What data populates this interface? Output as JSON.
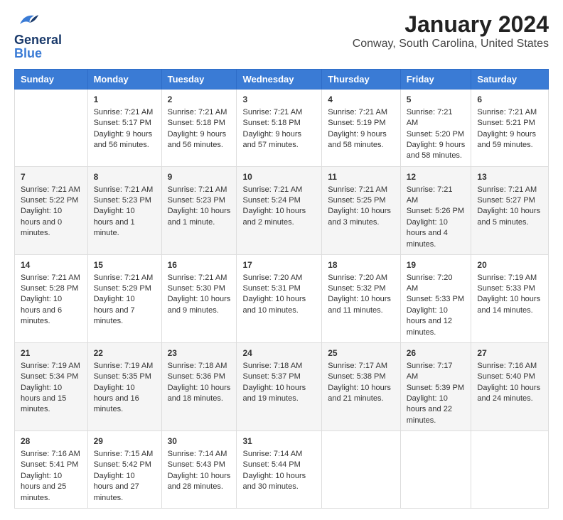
{
  "header": {
    "logo_general": "General",
    "logo_blue": "Blue",
    "title": "January 2024",
    "subtitle": "Conway, South Carolina, United States"
  },
  "days_of_week": [
    "Sunday",
    "Monday",
    "Tuesday",
    "Wednesday",
    "Thursday",
    "Friday",
    "Saturday"
  ],
  "weeks": [
    [
      {
        "date": "",
        "sunrise": "",
        "sunset": "",
        "daylight": ""
      },
      {
        "date": "1",
        "sunrise": "Sunrise: 7:21 AM",
        "sunset": "Sunset: 5:17 PM",
        "daylight": "Daylight: 9 hours and 56 minutes."
      },
      {
        "date": "2",
        "sunrise": "Sunrise: 7:21 AM",
        "sunset": "Sunset: 5:18 PM",
        "daylight": "Daylight: 9 hours and 56 minutes."
      },
      {
        "date": "3",
        "sunrise": "Sunrise: 7:21 AM",
        "sunset": "Sunset: 5:18 PM",
        "daylight": "Daylight: 9 hours and 57 minutes."
      },
      {
        "date": "4",
        "sunrise": "Sunrise: 7:21 AM",
        "sunset": "Sunset: 5:19 PM",
        "daylight": "Daylight: 9 hours and 58 minutes."
      },
      {
        "date": "5",
        "sunrise": "Sunrise: 7:21 AM",
        "sunset": "Sunset: 5:20 PM",
        "daylight": "Daylight: 9 hours and 58 minutes."
      },
      {
        "date": "6",
        "sunrise": "Sunrise: 7:21 AM",
        "sunset": "Sunset: 5:21 PM",
        "daylight": "Daylight: 9 hours and 59 minutes."
      }
    ],
    [
      {
        "date": "7",
        "sunrise": "Sunrise: 7:21 AM",
        "sunset": "Sunset: 5:22 PM",
        "daylight": "Daylight: 10 hours and 0 minutes."
      },
      {
        "date": "8",
        "sunrise": "Sunrise: 7:21 AM",
        "sunset": "Sunset: 5:23 PM",
        "daylight": "Daylight: 10 hours and 1 minute."
      },
      {
        "date": "9",
        "sunrise": "Sunrise: 7:21 AM",
        "sunset": "Sunset: 5:23 PM",
        "daylight": "Daylight: 10 hours and 1 minute."
      },
      {
        "date": "10",
        "sunrise": "Sunrise: 7:21 AM",
        "sunset": "Sunset: 5:24 PM",
        "daylight": "Daylight: 10 hours and 2 minutes."
      },
      {
        "date": "11",
        "sunrise": "Sunrise: 7:21 AM",
        "sunset": "Sunset: 5:25 PM",
        "daylight": "Daylight: 10 hours and 3 minutes."
      },
      {
        "date": "12",
        "sunrise": "Sunrise: 7:21 AM",
        "sunset": "Sunset: 5:26 PM",
        "daylight": "Daylight: 10 hours and 4 minutes."
      },
      {
        "date": "13",
        "sunrise": "Sunrise: 7:21 AM",
        "sunset": "Sunset: 5:27 PM",
        "daylight": "Daylight: 10 hours and 5 minutes."
      }
    ],
    [
      {
        "date": "14",
        "sunrise": "Sunrise: 7:21 AM",
        "sunset": "Sunset: 5:28 PM",
        "daylight": "Daylight: 10 hours and 6 minutes."
      },
      {
        "date": "15",
        "sunrise": "Sunrise: 7:21 AM",
        "sunset": "Sunset: 5:29 PM",
        "daylight": "Daylight: 10 hours and 7 minutes."
      },
      {
        "date": "16",
        "sunrise": "Sunrise: 7:21 AM",
        "sunset": "Sunset: 5:30 PM",
        "daylight": "Daylight: 10 hours and 9 minutes."
      },
      {
        "date": "17",
        "sunrise": "Sunrise: 7:20 AM",
        "sunset": "Sunset: 5:31 PM",
        "daylight": "Daylight: 10 hours and 10 minutes."
      },
      {
        "date": "18",
        "sunrise": "Sunrise: 7:20 AM",
        "sunset": "Sunset: 5:32 PM",
        "daylight": "Daylight: 10 hours and 11 minutes."
      },
      {
        "date": "19",
        "sunrise": "Sunrise: 7:20 AM",
        "sunset": "Sunset: 5:33 PM",
        "daylight": "Daylight: 10 hours and 12 minutes."
      },
      {
        "date": "20",
        "sunrise": "Sunrise: 7:19 AM",
        "sunset": "Sunset: 5:33 PM",
        "daylight": "Daylight: 10 hours and 14 minutes."
      }
    ],
    [
      {
        "date": "21",
        "sunrise": "Sunrise: 7:19 AM",
        "sunset": "Sunset: 5:34 PM",
        "daylight": "Daylight: 10 hours and 15 minutes."
      },
      {
        "date": "22",
        "sunrise": "Sunrise: 7:19 AM",
        "sunset": "Sunset: 5:35 PM",
        "daylight": "Daylight: 10 hours and 16 minutes."
      },
      {
        "date": "23",
        "sunrise": "Sunrise: 7:18 AM",
        "sunset": "Sunset: 5:36 PM",
        "daylight": "Daylight: 10 hours and 18 minutes."
      },
      {
        "date": "24",
        "sunrise": "Sunrise: 7:18 AM",
        "sunset": "Sunset: 5:37 PM",
        "daylight": "Daylight: 10 hours and 19 minutes."
      },
      {
        "date": "25",
        "sunrise": "Sunrise: 7:17 AM",
        "sunset": "Sunset: 5:38 PM",
        "daylight": "Daylight: 10 hours and 21 minutes."
      },
      {
        "date": "26",
        "sunrise": "Sunrise: 7:17 AM",
        "sunset": "Sunset: 5:39 PM",
        "daylight": "Daylight: 10 hours and 22 minutes."
      },
      {
        "date": "27",
        "sunrise": "Sunrise: 7:16 AM",
        "sunset": "Sunset: 5:40 PM",
        "daylight": "Daylight: 10 hours and 24 minutes."
      }
    ],
    [
      {
        "date": "28",
        "sunrise": "Sunrise: 7:16 AM",
        "sunset": "Sunset: 5:41 PM",
        "daylight": "Daylight: 10 hours and 25 minutes."
      },
      {
        "date": "29",
        "sunrise": "Sunrise: 7:15 AM",
        "sunset": "Sunset: 5:42 PM",
        "daylight": "Daylight: 10 hours and 27 minutes."
      },
      {
        "date": "30",
        "sunrise": "Sunrise: 7:14 AM",
        "sunset": "Sunset: 5:43 PM",
        "daylight": "Daylight: 10 hours and 28 minutes."
      },
      {
        "date": "31",
        "sunrise": "Sunrise: 7:14 AM",
        "sunset": "Sunset: 5:44 PM",
        "daylight": "Daylight: 10 hours and 30 minutes."
      },
      {
        "date": "",
        "sunrise": "",
        "sunset": "",
        "daylight": ""
      },
      {
        "date": "",
        "sunrise": "",
        "sunset": "",
        "daylight": ""
      },
      {
        "date": "",
        "sunrise": "",
        "sunset": "",
        "daylight": ""
      }
    ]
  ]
}
